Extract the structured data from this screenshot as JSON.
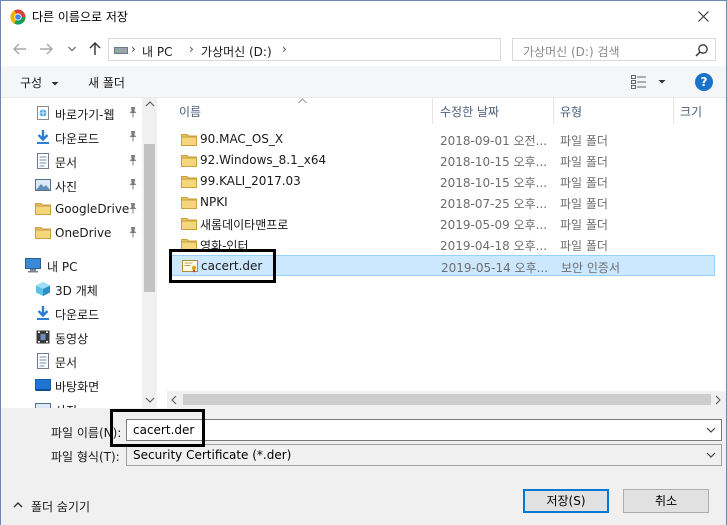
{
  "window": {
    "title": "다른 이름으로 저장"
  },
  "address": {
    "crumbs": [
      "내 PC",
      "가상머신 (D:)"
    ],
    "search_placeholder": "가상머신 (D:) 검색"
  },
  "toolbar": {
    "organize_label": "구성",
    "new_folder_label": "새 폴더"
  },
  "nav": {
    "items": [
      {
        "label": "바로가기-웹",
        "icon": "web-shortcut-icon",
        "pinned": true
      },
      {
        "label": "다운로드",
        "icon": "download-icon",
        "pinned": true
      },
      {
        "label": "문서",
        "icon": "document-icon",
        "pinned": true
      },
      {
        "label": "사진",
        "icon": "picture-icon",
        "pinned": true
      },
      {
        "label": "GoogleDrive",
        "icon": "folder-icon",
        "pinned": true
      },
      {
        "label": "OneDrive",
        "icon": "folder-icon",
        "pinned": true
      },
      {
        "label": "내 PC",
        "icon": "computer-icon",
        "pinned": false
      },
      {
        "label": "3D 개체",
        "icon": "3d-objects-icon",
        "pinned": false
      },
      {
        "label": "다운로드",
        "icon": "download-icon",
        "pinned": false
      },
      {
        "label": "동영상",
        "icon": "video-icon",
        "pinned": false
      },
      {
        "label": "문서",
        "icon": "document-icon",
        "pinned": false
      },
      {
        "label": "바탕화면",
        "icon": "desktop-icon",
        "pinned": false
      },
      {
        "label": "사진",
        "icon": "picture-icon",
        "pinned": false
      }
    ]
  },
  "columns": {
    "name": "이름",
    "modified": "수정한 날짜",
    "type": "유형",
    "size": "크기"
  },
  "files": [
    {
      "name": "90.MAC_OS_X",
      "date": "2018-09-01 오전...",
      "type": "파일 폴더",
      "icon": "folder-icon"
    },
    {
      "name": "92.Windows_8.1_x64",
      "date": "2018-10-15 오후...",
      "type": "파일 폴더",
      "icon": "folder-icon"
    },
    {
      "name": "99.KALI_2017.03",
      "date": "2018-10-15 오후...",
      "type": "파일 폴더",
      "icon": "folder-icon"
    },
    {
      "name": "NPKI",
      "date": "2018-07-25 오후...",
      "type": "파일 폴더",
      "icon": "folder-icon"
    },
    {
      "name": "새롬데이타맨프로",
      "date": "2019-05-09 오후...",
      "type": "파일 폴더",
      "icon": "folder-icon"
    },
    {
      "name": "영화-인터",
      "date": "2019-04-18 오후...",
      "type": "파일 폴더",
      "icon": "folder-icon"
    },
    {
      "name": "cacert.der",
      "date": "2019-05-14 오후...",
      "type": "보안 인증서",
      "icon": "certificate-icon"
    }
  ],
  "form": {
    "filename_label": "파일 이름(N):",
    "filename_value": "cacert.der",
    "filetype_label": "파일 형식(T):",
    "filetype_value": "Security Certificate (*.der)"
  },
  "footer": {
    "hide_folders_label": "폴더 숨기기",
    "save_label": "저장(S)",
    "cancel_label": "취소"
  },
  "colors": {
    "selection": "#cce8ff",
    "accent": "#0078d7",
    "folder": "#e8c160"
  }
}
